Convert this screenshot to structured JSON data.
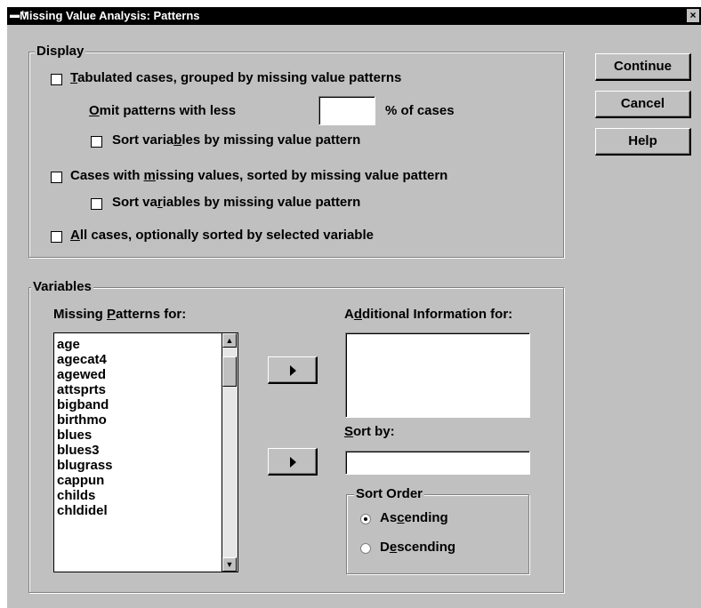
{
  "window": {
    "title": "Missing Value Analysis: Patterns",
    "system_menu_icon": "system-menu-icon",
    "close_glyph": "×"
  },
  "display_group": {
    "label": "Display",
    "tabulated_cases": {
      "label_u": "T",
      "label_rest": "abulated cases, grouped by missing value patterns",
      "checked": false
    },
    "omit_patterns": {
      "label_u": "O",
      "label_rest": "mit patterns with less",
      "value": "",
      "suffix": "% of cases"
    },
    "sort_vars_1": {
      "label_pre": "Sort varia",
      "label_u": "b",
      "label_rest": "les by missing value pattern",
      "checked": false
    },
    "cases_with_missing": {
      "label_pre": "Cases with ",
      "label_u": "m",
      "label_rest": "issing values, sorted by missing value pattern",
      "checked": false
    },
    "sort_vars_2": {
      "label_pre": "Sort va",
      "label_u": "r",
      "label_rest": "iables by missing value pattern",
      "checked": false
    },
    "all_cases": {
      "label_u": "A",
      "label_rest": "ll cases, optionally sorted by selected variable",
      "checked": false
    }
  },
  "buttons": {
    "continue": "Continue",
    "cancel": "Cancel",
    "help": "Help"
  },
  "variables_group": {
    "label": "Variables",
    "missing_patterns_label_pre": "Missing ",
    "missing_patterns_label_u": "P",
    "missing_patterns_label_rest": "atterns for:",
    "variables": [
      "age",
      "agecat4",
      "agewed",
      "attsprts",
      "bigband",
      "birthmo",
      "blues",
      "blues3",
      "blugrass",
      "cappun",
      "childs",
      "chldidel"
    ],
    "additional_info_label_pre": "A",
    "additional_info_label_u": "d",
    "additional_info_label_rest": "ditional Information for:",
    "sort_by_label_u": "S",
    "sort_by_label_rest": "ort by:",
    "sort_by_value": "",
    "sort_order": {
      "label": "Sort Order",
      "ascending": {
        "label_pre": "As",
        "label_u": "c",
        "label_rest": "ending",
        "selected": true
      },
      "descending": {
        "label_pre": "D",
        "label_u": "e",
        "label_rest": "scending",
        "selected": false
      }
    }
  }
}
